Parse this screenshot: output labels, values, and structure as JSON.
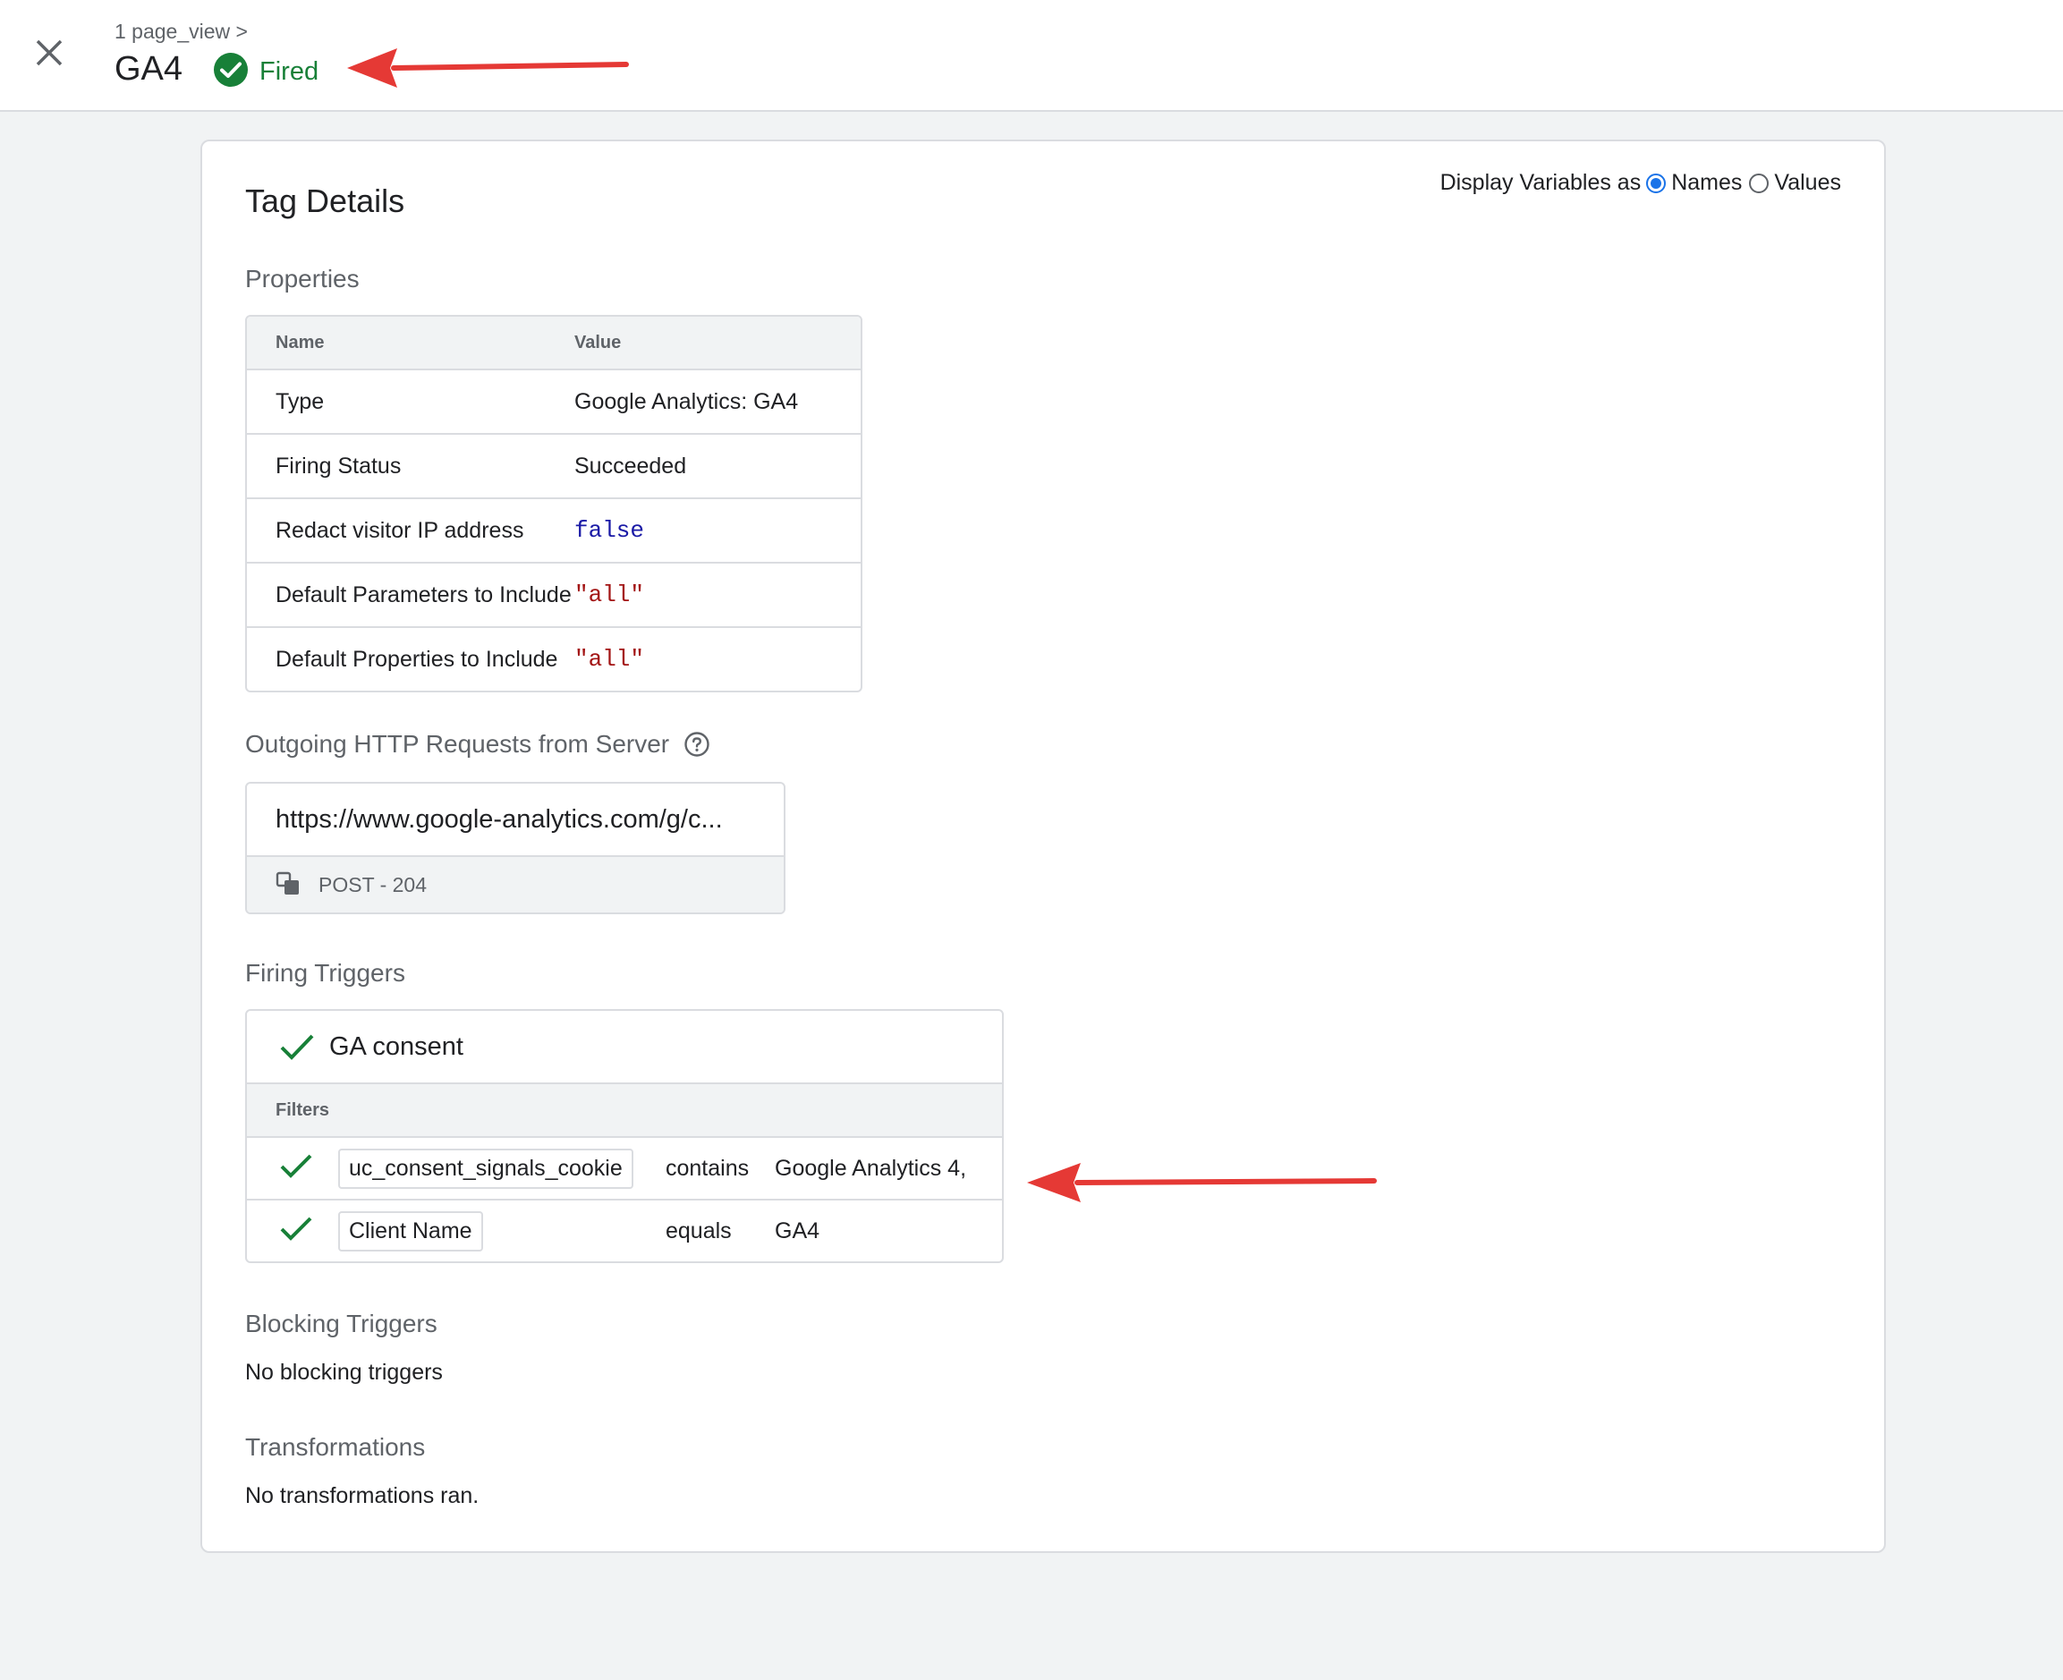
{
  "header": {
    "breadcrumb": "1 page_view >",
    "tag_name": "GA4",
    "status": "Fired"
  },
  "card": {
    "title": "Tag Details",
    "display_vars": {
      "label": "Display Variables as",
      "opt_names": "Names",
      "opt_values": "Values",
      "selected": "Names"
    }
  },
  "properties": {
    "heading": "Properties",
    "col_name": "Name",
    "col_value": "Value",
    "rows": [
      {
        "name": "Type",
        "value": "Google Analytics: GA4"
      },
      {
        "name": "Firing Status",
        "value": "Succeeded"
      },
      {
        "name": "Redact visitor IP address",
        "value": "false"
      },
      {
        "name": "Default Parameters to Include",
        "value": "\"all\""
      },
      {
        "name": "Default Properties to Include",
        "value": "\"all\""
      }
    ]
  },
  "requests": {
    "heading": "Outgoing HTTP Requests from Server",
    "url": "https://www.google-analytics.com/g/c...",
    "status": "POST - 204"
  },
  "firing_triggers": {
    "heading": "Firing Triggers",
    "trigger_name": "GA consent",
    "filters_label": "Filters",
    "filters": [
      {
        "variable": "uc_consent_signals_cookie",
        "operator": "contains",
        "value": "Google Analytics 4,"
      },
      {
        "variable": "Client Name",
        "operator": "equals",
        "value": "GA4"
      }
    ]
  },
  "blocking": {
    "heading": "Blocking Triggers",
    "text": "No blocking triggers"
  },
  "transformations": {
    "heading": "Transformations",
    "text": "No transformations ran."
  },
  "colors": {
    "success": "#188038",
    "accent": "#1a73e8",
    "annotation_arrow": "#e53935",
    "boolean": "#1a1aa6",
    "string": "#a31515"
  }
}
